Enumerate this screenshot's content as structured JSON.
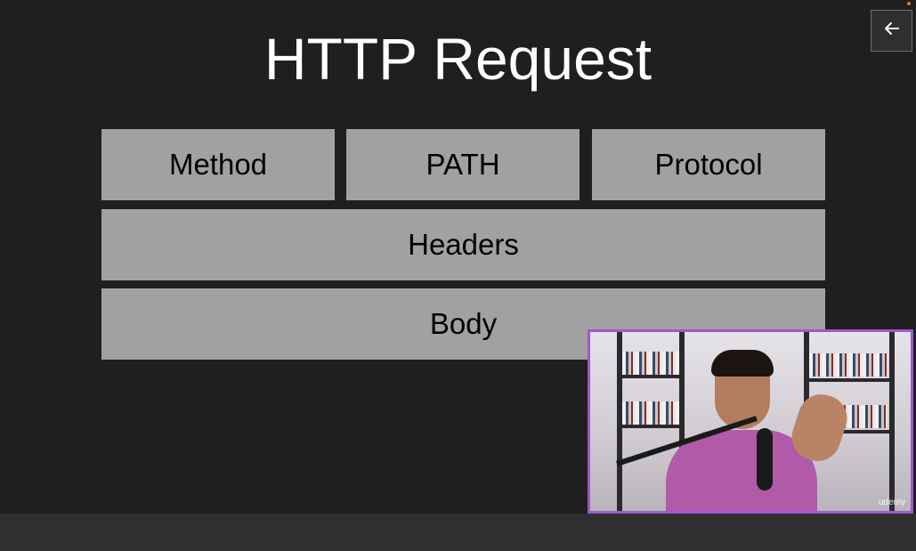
{
  "slide": {
    "title": "HTTP Request",
    "boxes": {
      "method": "Method",
      "path": "PATH",
      "protocol": "Protocol",
      "headers": "Headers",
      "body": "Body"
    }
  },
  "controls": {
    "back_icon": "arrow-left-icon"
  },
  "pip": {
    "watermark": "udemy"
  },
  "colors": {
    "slide_background": "#1f1f1f",
    "box_fill": "#a1a1a1",
    "pip_border": "#9b59d0",
    "page_background": "#2d2f31"
  }
}
